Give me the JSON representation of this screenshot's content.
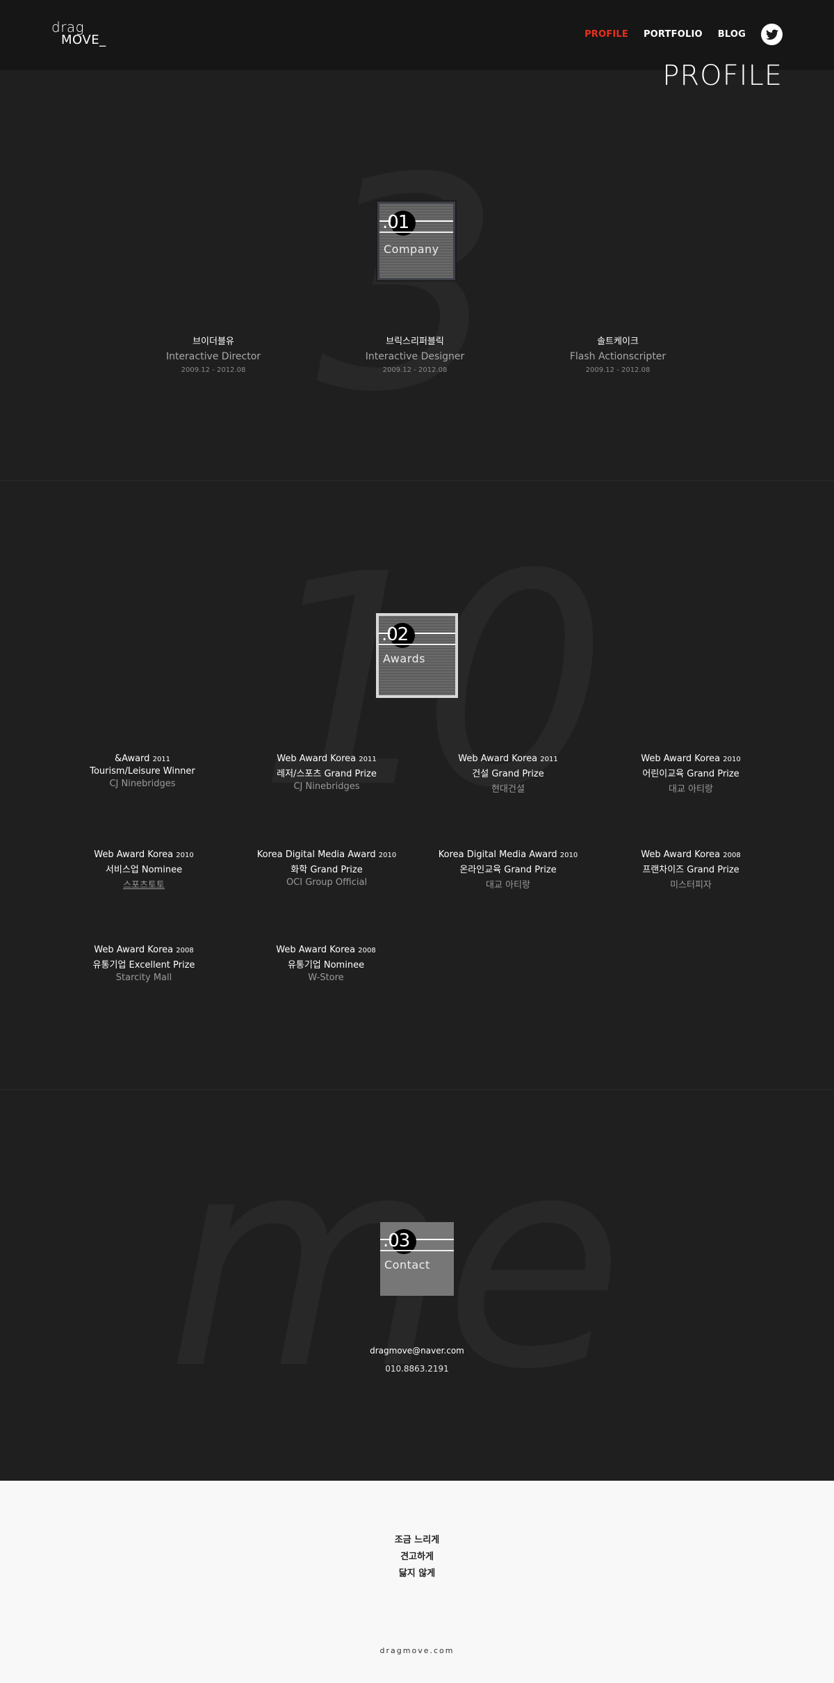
{
  "header": {
    "logo_line1": "drag",
    "logo_line2": "MOVE_",
    "nav": [
      "PROFILE",
      "PORTFOLIO",
      "BLOG"
    ],
    "active_nav": "PROFILE",
    "twitter_icon": "twitter-icon",
    "accent_color": "#e8301c"
  },
  "page_title": "PROFILE",
  "company_section": {
    "bg_glyph": "3",
    "badge_number": ".01",
    "badge_label": "Company",
    "items": [
      {
        "name": "브이더블유",
        "role": "Interactive Director",
        "period": "2009.12 - 2012.08"
      },
      {
        "name": "브릭스리퍼블릭",
        "role": "Interactive Designer",
        "period": "2009.12 - 2012.08"
      },
      {
        "name": "솔트케이크",
        "role": "Flash Actionscripter",
        "period": "2009.12 - 2012.08"
      }
    ]
  },
  "awards_section": {
    "bg_glyph": "10",
    "badge_number": ".02",
    "badge_label": "Awards",
    "items": [
      {
        "title": "&Award",
        "year": "2011",
        "prize": "Tourism/Leisure Winner",
        "client": "CJ Ninebridges"
      },
      {
        "title": "Web Award Korea",
        "year": "2011",
        "prize": "레저/스포츠 Grand Prize",
        "client": "CJ Ninebridges"
      },
      {
        "title": "Web Award Korea",
        "year": "2011",
        "prize": "건설 Grand Prize",
        "client": "현대건설"
      },
      {
        "title": "Web Award Korea",
        "year": "2010",
        "prize": "어린이교육 Grand Prize",
        "client": "대교 아티랑"
      },
      {
        "title": "Web Award Korea",
        "year": "2010",
        "prize": "서비스업 Nominee",
        "client": "스포츠토토"
      },
      {
        "title": "Korea Digital Media Award",
        "year": "2010",
        "prize": "화학 Grand Prize",
        "client": "OCI Group Official"
      },
      {
        "title": "Korea Digital Media Award",
        "year": "2010",
        "prize": "온라인교육 Grand Prize",
        "client": "대교 아티랑"
      },
      {
        "title": "Web Award Korea",
        "year": "2008",
        "prize": "프랜차이즈 Grand Prize",
        "client": "미스터피자"
      },
      {
        "title": "Web Award Korea",
        "year": "2008",
        "prize": "유통기업 Excellent Prize",
        "client": "Starcity Mall"
      },
      {
        "title": "Web Award Korea",
        "year": "2008",
        "prize": "유통기업 Nominee",
        "client": "W-Store"
      }
    ]
  },
  "contact_section": {
    "bg_glyph": "me",
    "badge_number": ".03",
    "badge_label": "Contact",
    "email": "dragmove@naver.com",
    "phone": "010.8863.2191"
  },
  "footer": {
    "slogan": [
      "조금 느리게",
      "견고하게",
      "닳지 않게"
    ],
    "site": "dragmove.com"
  }
}
